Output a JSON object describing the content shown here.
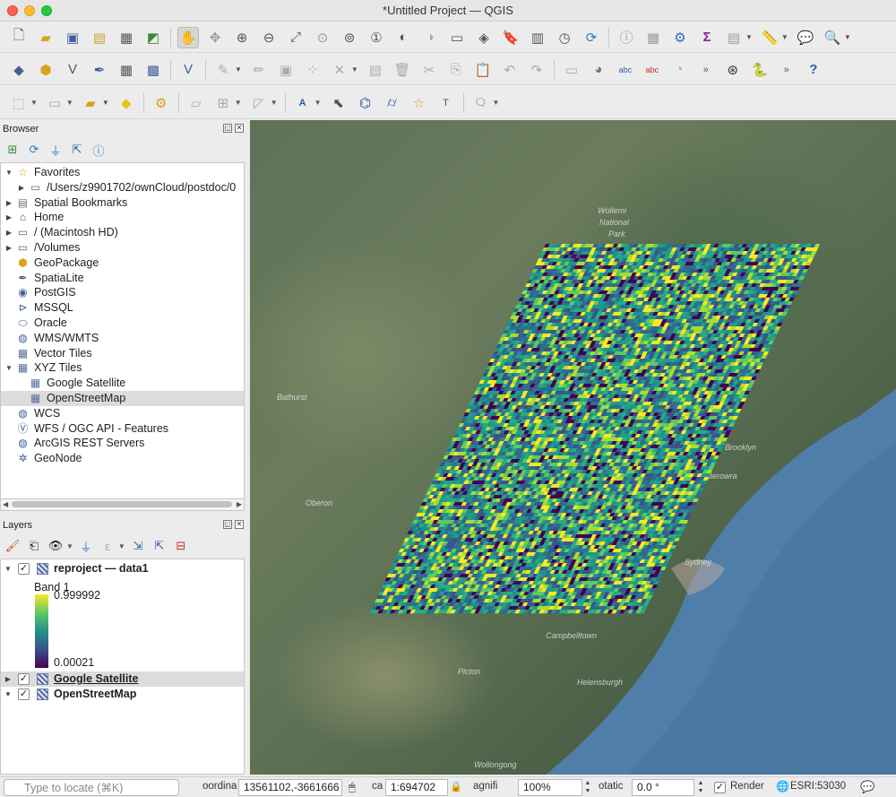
{
  "window": {
    "title": "*Untitled Project — QGIS"
  },
  "browser": {
    "title": "Browser",
    "items": [
      {
        "label": "Favorites",
        "icon": "star-icon",
        "depth": 0,
        "arrow": "down"
      },
      {
        "label": "/Users/z9901702/ownCloud/postdoc/0",
        "icon": "folder-icon",
        "depth": 1,
        "arrow": "right"
      },
      {
        "label": "Spatial Bookmarks",
        "icon": "bookmark-icon",
        "depth": 0,
        "arrow": "right"
      },
      {
        "label": "Home",
        "icon": "home-folder-icon",
        "depth": 0,
        "arrow": "right"
      },
      {
        "label": "/ (Macintosh HD)",
        "icon": "folder-icon",
        "depth": 0,
        "arrow": "right"
      },
      {
        "label": "/Volumes",
        "icon": "folder-icon",
        "depth": 0,
        "arrow": "right"
      },
      {
        "label": "GeoPackage",
        "icon": "geopackage-icon",
        "depth": 0,
        "arrow": ""
      },
      {
        "label": "SpatiaLite",
        "icon": "spatialite-icon",
        "depth": 0,
        "arrow": ""
      },
      {
        "label": "PostGIS",
        "icon": "postgis-elephant-icon",
        "depth": 0,
        "arrow": ""
      },
      {
        "label": "MSSQL",
        "icon": "mssql-icon",
        "depth": 0,
        "arrow": ""
      },
      {
        "label": "Oracle",
        "icon": "oracle-icon",
        "depth": 0,
        "arrow": ""
      },
      {
        "label": "WMS/WMTS",
        "icon": "globe-icon",
        "depth": 0,
        "arrow": ""
      },
      {
        "label": "Vector Tiles",
        "icon": "grid-icon",
        "depth": 0,
        "arrow": ""
      },
      {
        "label": "XYZ Tiles",
        "icon": "grid-icon",
        "depth": 0,
        "arrow": "down"
      },
      {
        "label": "Google Satellite",
        "icon": "grid-icon",
        "depth": 1,
        "arrow": ""
      },
      {
        "label": "OpenStreetMap",
        "icon": "grid-icon",
        "depth": 1,
        "arrow": "",
        "selected": true
      },
      {
        "label": "WCS",
        "icon": "globe-icon",
        "depth": 0,
        "arrow": ""
      },
      {
        "label": "WFS / OGC API - Features",
        "icon": "wfs-icon",
        "depth": 0,
        "arrow": ""
      },
      {
        "label": "ArcGIS REST Servers",
        "icon": "globe-icon",
        "depth": 0,
        "arrow": ""
      },
      {
        "label": "GeoNode",
        "icon": "geonode-icon",
        "depth": 0,
        "arrow": ""
      }
    ]
  },
  "layers": {
    "title": "Layers",
    "items": [
      {
        "label": "reproject — data1",
        "checked": true,
        "arrow": "down",
        "underline": false,
        "selected": false
      },
      {
        "label": "Google Satellite",
        "checked": true,
        "arrow": "right",
        "underline": true,
        "selected": true
      },
      {
        "label": "OpenStreetMap",
        "checked": true,
        "arrow": "down",
        "underline": false,
        "selected": false
      }
    ],
    "legend": {
      "band": "Band 1",
      "max": "0.999992",
      "min": "0.00021"
    }
  },
  "map": {
    "places": [
      "Wollemi",
      "National",
      "Park",
      "Bathurst",
      "Oberon",
      "Sydney",
      "Campbelltown",
      "Picton",
      "Helensburgh",
      "Wollongong",
      "Berowra",
      "Brooklyn"
    ]
  },
  "status": {
    "locate_placeholder": "Type to locate (⌘K)",
    "coord_label": "oordina",
    "coordinate": "13561102,-3661666",
    "scale_label": "ca",
    "scale": "1:694702",
    "magnifier_label": "agnifi",
    "magnifier": "100%",
    "rotation_label": "otatic",
    "rotation": "0.0 °",
    "render_label": "Render",
    "crs": "ESRI:53030"
  }
}
